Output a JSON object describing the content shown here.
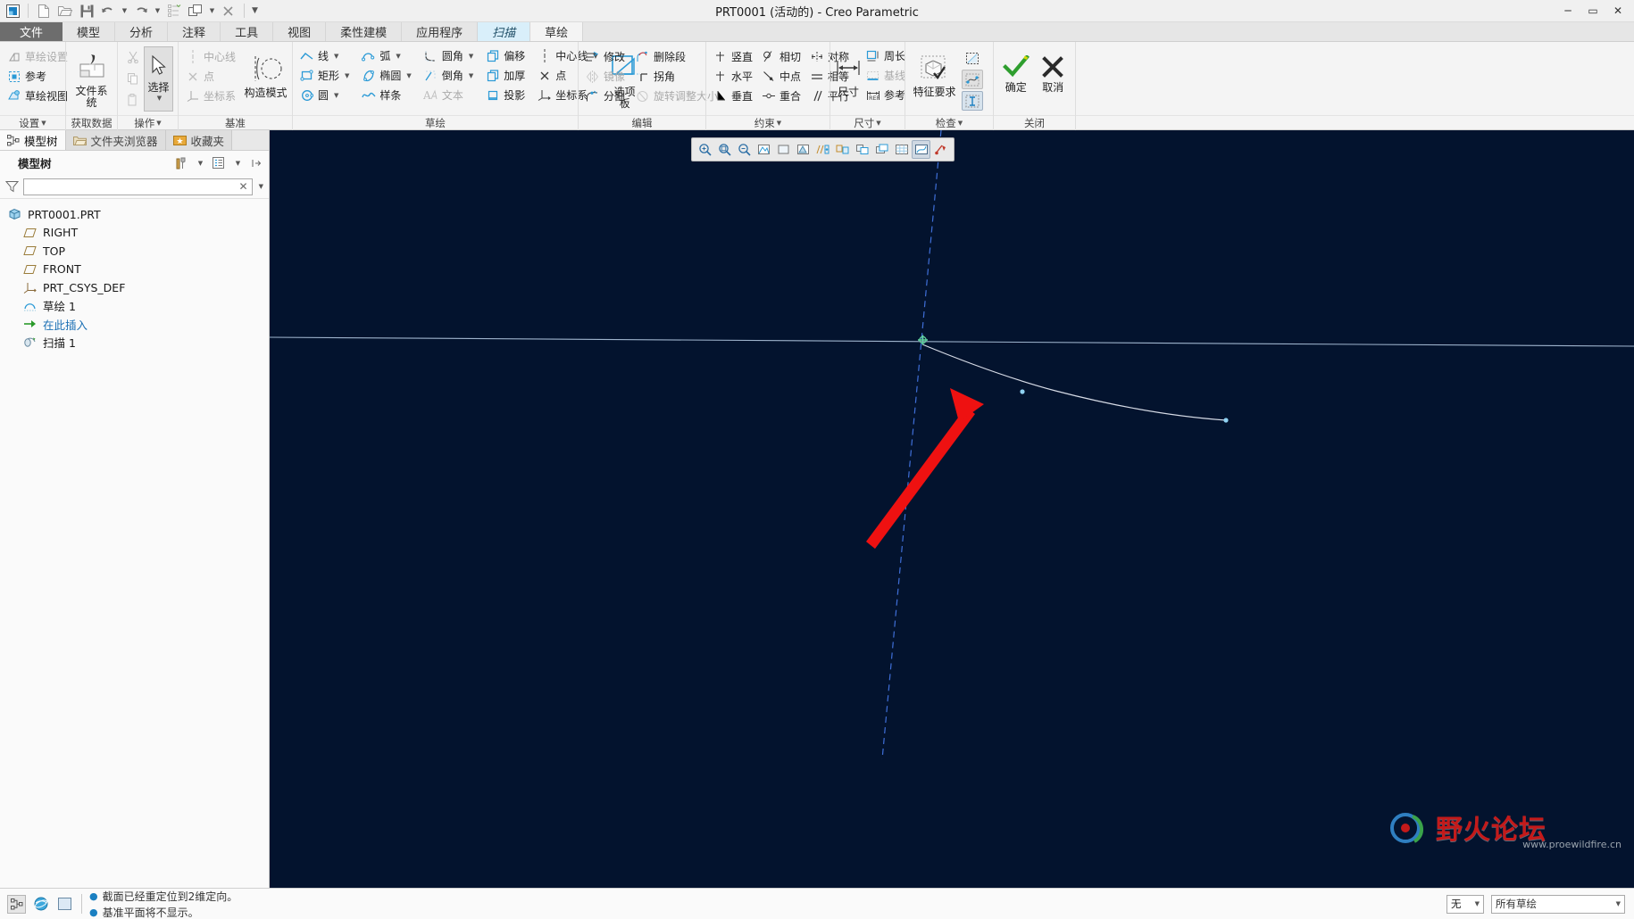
{
  "window": {
    "title": "PRT0001 (活动的) - Creo Parametric",
    "minimize": "─",
    "maximize": "▭",
    "close": "✕"
  },
  "quick_access": {
    "items": [
      {
        "name": "app-logo-icon",
        "label": ""
      },
      {
        "name": "new-file-icon",
        "label": ""
      },
      {
        "name": "open-file-icon",
        "label": ""
      },
      {
        "name": "save-icon",
        "label": ""
      },
      {
        "name": "undo-icon",
        "label": ""
      },
      {
        "name": "redo-icon",
        "label": ""
      },
      {
        "name": "regenerate-icon",
        "label": ""
      },
      {
        "name": "window-switch-icon",
        "label": ""
      },
      {
        "name": "close-window-icon",
        "label": ""
      },
      {
        "name": "customize-qat-icon",
        "label": ""
      }
    ]
  },
  "ribbon": {
    "tabs": [
      {
        "label": "文件",
        "state": "file"
      },
      {
        "label": "模型",
        "state": "normal"
      },
      {
        "label": "分析",
        "state": "normal"
      },
      {
        "label": "注释",
        "state": "normal"
      },
      {
        "label": "工具",
        "state": "normal"
      },
      {
        "label": "视图",
        "state": "normal"
      },
      {
        "label": "柔性建模",
        "state": "normal"
      },
      {
        "label": "应用程序",
        "state": "normal"
      },
      {
        "label": "扫描",
        "state": "active"
      },
      {
        "label": "草绘",
        "state": "current"
      }
    ],
    "groups": {
      "settings": {
        "label": "设置",
        "items": [
          {
            "label": "草绘设置",
            "icon": "sketch-setup-icon",
            "disabled": true
          },
          {
            "label": "参考",
            "icon": "reference-icon",
            "disabled": false
          },
          {
            "label": "草绘视图",
            "icon": "sketch-view-icon",
            "disabled": false
          }
        ]
      },
      "get_data": {
        "label": "获取数据",
        "items": [
          {
            "label": "文件系统",
            "icon": "file-system-icon"
          }
        ]
      },
      "operations": {
        "label": "操作",
        "items": [
          {
            "label": "剪切",
            "icon": "cut-icon",
            "disabled": true
          },
          {
            "label": "复制",
            "icon": "copy-icon",
            "disabled": true
          },
          {
            "label": "粘贴",
            "icon": "paste-icon",
            "disabled": true
          },
          {
            "label": "选择",
            "icon": "select-arrow-icon",
            "disabled": false
          }
        ]
      },
      "datum": {
        "label": "基准",
        "items": [
          {
            "label": "中心线",
            "icon": "centerline-icon",
            "disabled": true
          },
          {
            "label": "点",
            "icon": "point-icon",
            "disabled": true
          },
          {
            "label": "坐标系",
            "icon": "coord-system-icon",
            "disabled": true
          },
          {
            "label": "构造模式",
            "icon": "construction-mode-icon",
            "disabled": false
          }
        ]
      },
      "sketching": {
        "label": "草绘",
        "items": [
          {
            "label": "线",
            "icon": "line-icon",
            "dropdown": true
          },
          {
            "label": "矩形",
            "icon": "rectangle-icon",
            "dropdown": true
          },
          {
            "label": "圆",
            "icon": "circle-icon",
            "dropdown": true
          },
          {
            "label": "弧",
            "icon": "arc-icon",
            "dropdown": true
          },
          {
            "label": "椭圆",
            "icon": "ellipse-icon",
            "dropdown": true
          },
          {
            "label": "样条",
            "icon": "spline-icon",
            "dropdown": false
          },
          {
            "label": "圆角",
            "icon": "fillet-icon",
            "dropdown": true
          },
          {
            "label": "倒角",
            "icon": "chamfer-icon",
            "dropdown": true
          },
          {
            "label": "文本",
            "icon": "text-icon",
            "dropdown": false,
            "disabled": true
          },
          {
            "label": "偏移",
            "icon": "offset-icon",
            "dropdown": false
          },
          {
            "label": "加厚",
            "icon": "thicken-icon",
            "dropdown": false
          },
          {
            "label": "投影",
            "icon": "project-icon",
            "dropdown": false
          },
          {
            "label": "中心线",
            "icon": "centerline-icon",
            "dropdown": true
          },
          {
            "label": "点",
            "icon": "point-icon",
            "dropdown": false
          },
          {
            "label": "坐标系",
            "icon": "coord-system-icon",
            "dropdown": false
          },
          {
            "label": "选项板",
            "icon": "palette-icon",
            "dropdown": false
          }
        ]
      },
      "editing": {
        "label": "编辑",
        "items": [
          {
            "label": "修改",
            "icon": "modify-icon",
            "disabled": false
          },
          {
            "label": "镜像",
            "icon": "mirror-icon",
            "disabled": true
          },
          {
            "label": "分割",
            "icon": "divide-icon",
            "disabled": false
          },
          {
            "label": "删除段",
            "icon": "delete-segment-icon",
            "disabled": false
          },
          {
            "label": "拐角",
            "icon": "corner-icon",
            "disabled": false
          },
          {
            "label": "旋转调整大小",
            "icon": "rotate-resize-icon",
            "disabled": true
          }
        ]
      },
      "constraints": {
        "label": "约束",
        "items": [
          {
            "label": "竖直",
            "icon": "vertical-constraint-icon"
          },
          {
            "label": "水平",
            "icon": "horizontal-constraint-icon"
          },
          {
            "label": "垂直",
            "icon": "perpendicular-constraint-icon"
          },
          {
            "label": "相切",
            "icon": "tangent-constraint-icon"
          },
          {
            "label": "中点",
            "icon": "midpoint-constraint-icon"
          },
          {
            "label": "重合",
            "icon": "coincident-constraint-icon"
          },
          {
            "label": "对称",
            "icon": "symmetric-constraint-icon"
          },
          {
            "label": "相等",
            "icon": "equal-constraint-icon"
          },
          {
            "label": "平行",
            "icon": "parallel-constraint-icon"
          }
        ]
      },
      "dimension": {
        "label": "尺寸",
        "items": [
          {
            "label": "尺寸",
            "icon": "dimension-icon"
          },
          {
            "label": "周长",
            "icon": "perimeter-icon"
          },
          {
            "label": "基线",
            "icon": "baseline-icon",
            "disabled": true
          },
          {
            "label": "参考",
            "icon": "reference-dim-icon"
          }
        ]
      },
      "inspect": {
        "label": "检查",
        "items": [
          {
            "label": "特征要求",
            "icon": "feature-requirements-icon"
          },
          {
            "label": "着色封闭环",
            "icon": "shade-closed-loop-icon"
          },
          {
            "label": "加亮开放端",
            "icon": "highlight-open-ends-icon"
          },
          {
            "label": "重叠几何",
            "icon": "overlapping-geometry-icon"
          }
        ]
      },
      "close": {
        "label": "关闭",
        "items": [
          {
            "label": "确定",
            "icon": "ok-check-icon"
          },
          {
            "label": "取消",
            "icon": "cancel-x-icon"
          }
        ]
      }
    }
  },
  "left_panel": {
    "tabs": [
      {
        "label": "模型树",
        "icon": "model-tree-icon",
        "active": true
      },
      {
        "label": "文件夹浏览器",
        "icon": "folder-browser-icon",
        "active": false
      },
      {
        "label": "收藏夹",
        "icon": "favorites-icon",
        "active": false
      }
    ],
    "header_title": "模型树",
    "header_icons": [
      "tree-tools-icon",
      "tree-tools-caret-icon",
      "tree-display-icon",
      "tree-display-caret-icon",
      "collapse-icon"
    ],
    "filter": {
      "value": "",
      "placeholder": "",
      "icon": "filter-funnel-icon",
      "clear": "✕"
    },
    "tree_items": [
      {
        "label": "PRT0001.PRT",
        "icon": "part-icon",
        "indent": 0
      },
      {
        "label": "RIGHT",
        "icon": "datum-plane-icon",
        "indent": 1
      },
      {
        "label": "TOP",
        "icon": "datum-plane-icon",
        "indent": 1
      },
      {
        "label": "FRONT",
        "icon": "datum-plane-icon",
        "indent": 1
      },
      {
        "label": "PRT_CSYS_DEF",
        "icon": "csys-icon",
        "indent": 1
      },
      {
        "label": "草绘 1",
        "icon": "sketch-feature-icon",
        "indent": 1
      },
      {
        "label": "在此插入",
        "icon": "insert-here-icon",
        "indent": 1
      },
      {
        "label": "扫描 1",
        "icon": "sweep-feature-icon",
        "indent": 1
      }
    ]
  },
  "graphics_toolbar": {
    "buttons": [
      {
        "name": "zoom-in-icon",
        "selected": false
      },
      {
        "name": "refit-icon",
        "selected": false
      },
      {
        "name": "zoom-out-icon",
        "selected": false
      },
      {
        "name": "repaint-icon",
        "selected": false
      },
      {
        "name": "display-style-icon",
        "selected": false
      },
      {
        "name": "saved-views-icon",
        "selected": false
      },
      {
        "name": "datum-display-icon",
        "selected": false
      },
      {
        "name": "annotation-display-icon",
        "selected": false
      },
      {
        "name": "spin-center-icon",
        "selected": false
      },
      {
        "name": "layer-display-icon",
        "selected": false
      },
      {
        "name": "grid-display-icon",
        "selected": false
      },
      {
        "name": "sketch-display-icon",
        "selected": true
      },
      {
        "name": "sketch-orientation-icon",
        "selected": false
      }
    ]
  },
  "status_bar": {
    "icons": [
      {
        "name": "model-tree-toggle-icon",
        "framed": true
      },
      {
        "name": "browser-toggle-icon",
        "framed": false
      },
      {
        "name": "graphics-window-toggle-icon",
        "framed": false
      }
    ],
    "messages": [
      "截面已经重定位到2维定向。",
      "基准平面将不显示。"
    ],
    "selection_combo": "无",
    "selection_filter": "所有草绘"
  },
  "watermark": {
    "text": "野火论坛",
    "url": "www.proewildfire.cn"
  },
  "colors": {
    "graphics_background": "#03132e",
    "accent_blue": "#2b9ad6",
    "annotation_red": "#ee1111",
    "sketch_curve": "#c8d0e0",
    "construction_line": "#3a6fd8",
    "active_tab": "#d9effa"
  }
}
